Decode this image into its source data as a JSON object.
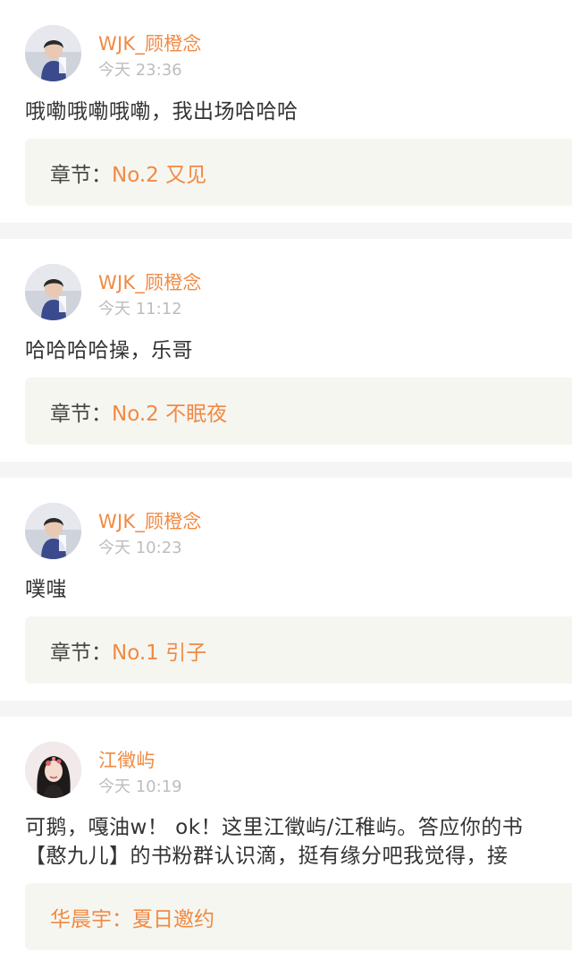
{
  "posts": [
    {
      "username": "WJK_顾橙念",
      "time": "今天 23:36",
      "content": [
        "哦嘞哦嘞哦嘞，我出场哈哈哈"
      ],
      "chapter_label": "章节：",
      "chapter_title": "No.2 又见",
      "avatar": "boy-avatar"
    },
    {
      "username": "WJK_顾橙念",
      "time": "今天 11:12",
      "content": [
        "哈哈哈哈操，乐哥"
      ],
      "chapter_label": "章节：",
      "chapter_title": "No.2 不眠夜",
      "avatar": "boy-avatar"
    },
    {
      "username": "WJK_顾橙念",
      "time": "今天 10:23",
      "content": [
        "噗嗤"
      ],
      "chapter_label": "章节：",
      "chapter_title": "No.1 引子",
      "avatar": "boy-avatar"
    },
    {
      "username": "江徵屿",
      "time": "今天 10:19",
      "content": [
        "可鹅，嘎油w！ ok！这里江徵屿/江稚屿。答应你的书",
        "【憨九儿】的书粉群认识滴，挺有缘分吧我觉得，接"
      ],
      "book_label": "华晨宇：夏日邀约",
      "avatar": "girl-avatar"
    }
  ],
  "colors": {
    "accent": "#f08a43",
    "timestamp": "#bdbdbd",
    "chapter_bg": "#f6f6f1",
    "divider": "#f5f5f5"
  }
}
